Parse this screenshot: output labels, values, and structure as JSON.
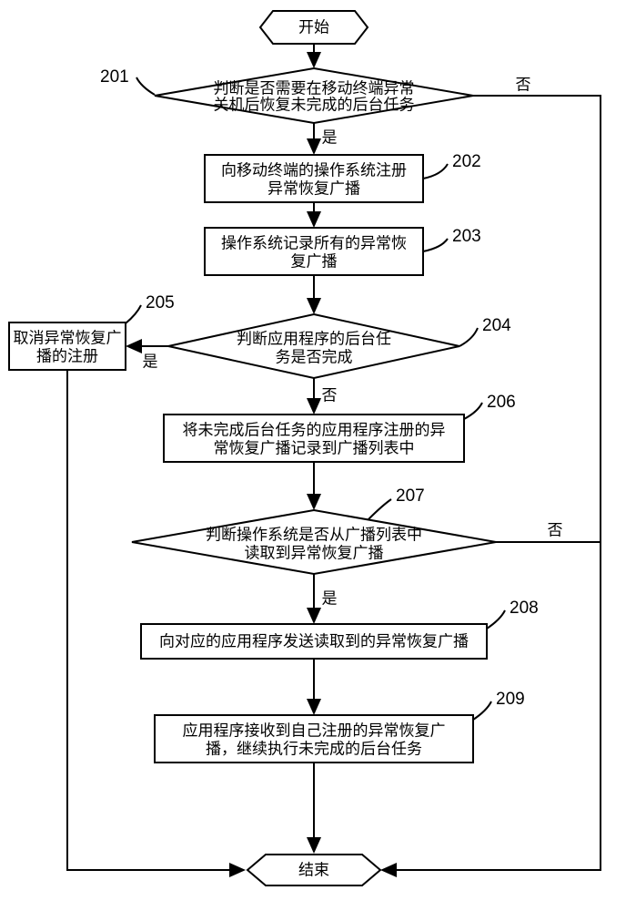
{
  "chart_data": {
    "type": "flowchart",
    "nodes": [
      {
        "id": "start",
        "shape": "terminator",
        "text": "开始"
      },
      {
        "id": "n201",
        "shape": "decision",
        "label": "201",
        "text1": "判断是否需要在移动终端异常",
        "text2": "关机后恢复未完成的后台任务"
      },
      {
        "id": "n202",
        "shape": "process",
        "label": "202",
        "text1": "向移动终端的操作系统注册",
        "text2": "异常恢复广播"
      },
      {
        "id": "n203",
        "shape": "process",
        "label": "203",
        "text1": "操作系统记录所有的异常恢",
        "text2": "复广播"
      },
      {
        "id": "n204",
        "shape": "decision",
        "label": "204",
        "text1": "判断应用程序的后台任",
        "text2": "务是否完成"
      },
      {
        "id": "n205",
        "shape": "process",
        "label": "205",
        "text1": "取消异常恢复广",
        "text2": "播的注册"
      },
      {
        "id": "n206",
        "shape": "process",
        "label": "206",
        "text1": "将未完成后台任务的应用程序注册的异",
        "text2": "常恢复广播记录到广播列表中"
      },
      {
        "id": "n207",
        "shape": "decision",
        "label": "207",
        "text1": "判断操作系统是否从广播列表中",
        "text2": "读取到异常恢复广播"
      },
      {
        "id": "n208",
        "shape": "process",
        "label": "208",
        "text1": "向对应的应用程序发送读取到的异常恢复广播"
      },
      {
        "id": "n209",
        "shape": "process",
        "label": "209",
        "text1": "应用程序接收到自己注册的异常恢复广",
        "text2": "播，继续执行未完成的后台任务"
      },
      {
        "id": "end",
        "shape": "terminator",
        "text": "结束"
      }
    ],
    "edges": [
      {
        "from": "start",
        "to": "n201"
      },
      {
        "from": "n201",
        "to": "n202",
        "label": "是"
      },
      {
        "from": "n201",
        "to": "end",
        "label": "否",
        "route": "right-down"
      },
      {
        "from": "n202",
        "to": "n203"
      },
      {
        "from": "n203",
        "to": "n204"
      },
      {
        "from": "n204",
        "to": "n206",
        "label": "否"
      },
      {
        "from": "n204",
        "to": "n205",
        "label": "是"
      },
      {
        "from": "n205",
        "to": "end",
        "route": "left-down"
      },
      {
        "from": "n206",
        "to": "n207"
      },
      {
        "from": "n207",
        "to": "n208",
        "label": "是"
      },
      {
        "from": "n207",
        "to": "end",
        "label": "否",
        "route": "right-down"
      },
      {
        "from": "n208",
        "to": "n209"
      },
      {
        "from": "n209",
        "to": "end"
      }
    ]
  },
  "labels": {
    "yes": "是",
    "no": "否"
  }
}
